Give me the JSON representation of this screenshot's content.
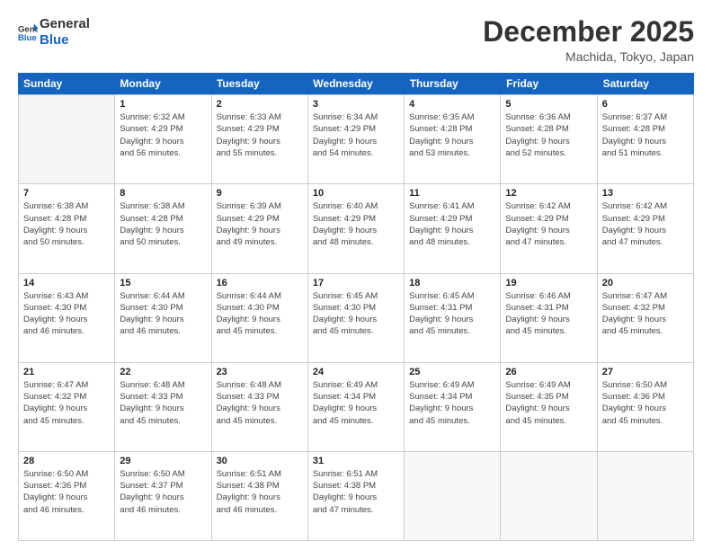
{
  "logo": {
    "line1": "General",
    "line2": "Blue"
  },
  "header": {
    "title": "December 2025",
    "location": "Machida, Tokyo, Japan"
  },
  "weekdays": [
    "Sunday",
    "Monday",
    "Tuesday",
    "Wednesday",
    "Thursday",
    "Friday",
    "Saturday"
  ],
  "rows": [
    [
      {
        "day": "",
        "info": [],
        "empty": true
      },
      {
        "day": "1",
        "info": [
          "Sunrise: 6:32 AM",
          "Sunset: 4:29 PM",
          "Daylight: 9 hours",
          "and 56 minutes."
        ]
      },
      {
        "day": "2",
        "info": [
          "Sunrise: 6:33 AM",
          "Sunset: 4:29 PM",
          "Daylight: 9 hours",
          "and 55 minutes."
        ]
      },
      {
        "day": "3",
        "info": [
          "Sunrise: 6:34 AM",
          "Sunset: 4:29 PM",
          "Daylight: 9 hours",
          "and 54 minutes."
        ]
      },
      {
        "day": "4",
        "info": [
          "Sunrise: 6:35 AM",
          "Sunset: 4:28 PM",
          "Daylight: 9 hours",
          "and 53 minutes."
        ]
      },
      {
        "day": "5",
        "info": [
          "Sunrise: 6:36 AM",
          "Sunset: 4:28 PM",
          "Daylight: 9 hours",
          "and 52 minutes."
        ]
      },
      {
        "day": "6",
        "info": [
          "Sunrise: 6:37 AM",
          "Sunset: 4:28 PM",
          "Daylight: 9 hours",
          "and 51 minutes."
        ]
      }
    ],
    [
      {
        "day": "7",
        "info": [
          "Sunrise: 6:38 AM",
          "Sunset: 4:28 PM",
          "Daylight: 9 hours",
          "and 50 minutes."
        ]
      },
      {
        "day": "8",
        "info": [
          "Sunrise: 6:38 AM",
          "Sunset: 4:28 PM",
          "Daylight: 9 hours",
          "and 50 minutes."
        ]
      },
      {
        "day": "9",
        "info": [
          "Sunrise: 6:39 AM",
          "Sunset: 4:29 PM",
          "Daylight: 9 hours",
          "and 49 minutes."
        ]
      },
      {
        "day": "10",
        "info": [
          "Sunrise: 6:40 AM",
          "Sunset: 4:29 PM",
          "Daylight: 9 hours",
          "and 48 minutes."
        ]
      },
      {
        "day": "11",
        "info": [
          "Sunrise: 6:41 AM",
          "Sunset: 4:29 PM",
          "Daylight: 9 hours",
          "and 48 minutes."
        ]
      },
      {
        "day": "12",
        "info": [
          "Sunrise: 6:42 AM",
          "Sunset: 4:29 PM",
          "Daylight: 9 hours",
          "and 47 minutes."
        ]
      },
      {
        "day": "13",
        "info": [
          "Sunrise: 6:42 AM",
          "Sunset: 4:29 PM",
          "Daylight: 9 hours",
          "and 47 minutes."
        ]
      }
    ],
    [
      {
        "day": "14",
        "info": [
          "Sunrise: 6:43 AM",
          "Sunset: 4:30 PM",
          "Daylight: 9 hours",
          "and 46 minutes."
        ]
      },
      {
        "day": "15",
        "info": [
          "Sunrise: 6:44 AM",
          "Sunset: 4:30 PM",
          "Daylight: 9 hours",
          "and 46 minutes."
        ]
      },
      {
        "day": "16",
        "info": [
          "Sunrise: 6:44 AM",
          "Sunset: 4:30 PM",
          "Daylight: 9 hours",
          "and 45 minutes."
        ]
      },
      {
        "day": "17",
        "info": [
          "Sunrise: 6:45 AM",
          "Sunset: 4:30 PM",
          "Daylight: 9 hours",
          "and 45 minutes."
        ]
      },
      {
        "day": "18",
        "info": [
          "Sunrise: 6:45 AM",
          "Sunset: 4:31 PM",
          "Daylight: 9 hours",
          "and 45 minutes."
        ]
      },
      {
        "day": "19",
        "info": [
          "Sunrise: 6:46 AM",
          "Sunset: 4:31 PM",
          "Daylight: 9 hours",
          "and 45 minutes."
        ]
      },
      {
        "day": "20",
        "info": [
          "Sunrise: 6:47 AM",
          "Sunset: 4:32 PM",
          "Daylight: 9 hours",
          "and 45 minutes."
        ]
      }
    ],
    [
      {
        "day": "21",
        "info": [
          "Sunrise: 6:47 AM",
          "Sunset: 4:32 PM",
          "Daylight: 9 hours",
          "and 45 minutes."
        ]
      },
      {
        "day": "22",
        "info": [
          "Sunrise: 6:48 AM",
          "Sunset: 4:33 PM",
          "Daylight: 9 hours",
          "and 45 minutes."
        ]
      },
      {
        "day": "23",
        "info": [
          "Sunrise: 6:48 AM",
          "Sunset: 4:33 PM",
          "Daylight: 9 hours",
          "and 45 minutes."
        ]
      },
      {
        "day": "24",
        "info": [
          "Sunrise: 6:49 AM",
          "Sunset: 4:34 PM",
          "Daylight: 9 hours",
          "and 45 minutes."
        ]
      },
      {
        "day": "25",
        "info": [
          "Sunrise: 6:49 AM",
          "Sunset: 4:34 PM",
          "Daylight: 9 hours",
          "and 45 minutes."
        ]
      },
      {
        "day": "26",
        "info": [
          "Sunrise: 6:49 AM",
          "Sunset: 4:35 PM",
          "Daylight: 9 hours",
          "and 45 minutes."
        ]
      },
      {
        "day": "27",
        "info": [
          "Sunrise: 6:50 AM",
          "Sunset: 4:36 PM",
          "Daylight: 9 hours",
          "and 45 minutes."
        ]
      }
    ],
    [
      {
        "day": "28",
        "info": [
          "Sunrise: 6:50 AM",
          "Sunset: 4:36 PM",
          "Daylight: 9 hours",
          "and 46 minutes."
        ]
      },
      {
        "day": "29",
        "info": [
          "Sunrise: 6:50 AM",
          "Sunset: 4:37 PM",
          "Daylight: 9 hours",
          "and 46 minutes."
        ]
      },
      {
        "day": "30",
        "info": [
          "Sunrise: 6:51 AM",
          "Sunset: 4:38 PM",
          "Daylight: 9 hours",
          "and 46 minutes."
        ]
      },
      {
        "day": "31",
        "info": [
          "Sunrise: 6:51 AM",
          "Sunset: 4:38 PM",
          "Daylight: 9 hours",
          "and 47 minutes."
        ]
      },
      {
        "day": "",
        "info": [],
        "empty": true
      },
      {
        "day": "",
        "info": [],
        "empty": true
      },
      {
        "day": "",
        "info": [],
        "empty": true
      }
    ]
  ]
}
